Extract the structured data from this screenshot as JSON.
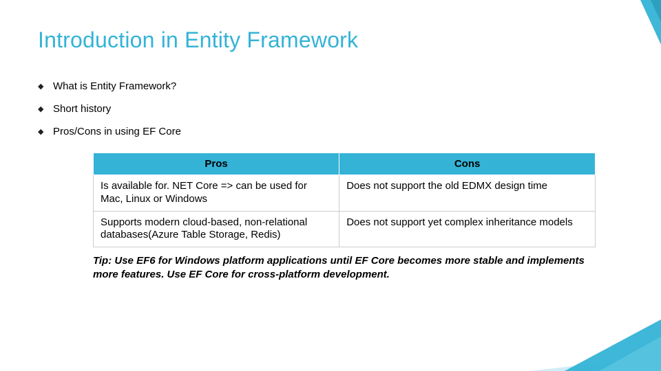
{
  "title": "Introduction in Entity Framework",
  "bullets": [
    "What is Entity Framework?",
    "Short history",
    "Pros/Cons in using EF Core"
  ],
  "table": {
    "headers": {
      "pros": "Pros",
      "cons": "Cons"
    },
    "rows": [
      {
        "pros": "Is available for. NET Core => can be used for Mac, Linux or Windows",
        "cons": "Does not support the old EDMX design time"
      },
      {
        "pros": "Supports modern cloud-based, non-relational databases(Azure Table Storage, Redis)",
        "cons": "Does not support yet complex inheritance models"
      }
    ]
  },
  "tip": "Tip: Use EF6 for Windows platform applications until EF Core becomes more stable and implements more features. Use EF Core for cross-platform development."
}
